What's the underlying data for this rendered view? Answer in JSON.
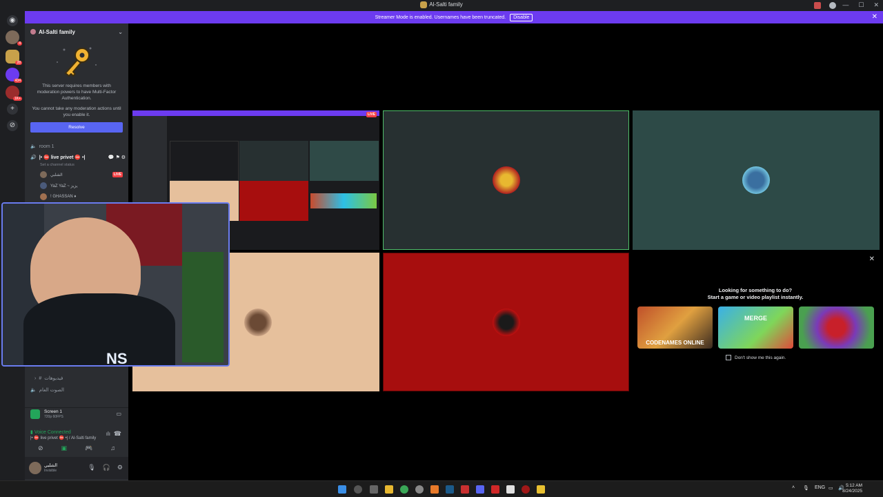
{
  "window": {
    "title": "Al-Salti family"
  },
  "banner": {
    "message": "Streamer Mode is enabled. Usernames have been truncated.",
    "disable_label": "Disable"
  },
  "rail": {
    "badges": [
      "4",
      "28",
      "434",
      "1K+"
    ]
  },
  "server": {
    "name": "Al-Salti family"
  },
  "mfa": {
    "line1": "This server requires members with moderation powers to have Multi-Factor Authentication.",
    "line2": "You cannot take any moderation actions until you enable it.",
    "resolve_label": "Resolve"
  },
  "channels": {
    "room1": "room 1",
    "live": "|• ⛔ live privet ⛔ •|",
    "status": "Set a channel status",
    "members": [
      {
        "name": "الشلبي",
        "live": "LIVE"
      },
      {
        "name": "YaZ YaZ ~ يزيز"
      },
      {
        "name": "! GHASSAN ♦"
      }
    ],
    "videos": "فيديوهات",
    "voice_general": "الصوت العام"
  },
  "screen_share": {
    "title": "Screen 1",
    "quality": "720p 60FPS"
  },
  "voice": {
    "status": "Voice Connected",
    "channel": "|• ⛔ live privet ⛔ •| / Al-Salti family"
  },
  "user": {
    "name": "الشلبي",
    "status": "Invisible"
  },
  "live_tag": "LIVE",
  "activity": {
    "heading1": "Looking for something to do?",
    "heading2": "Start a game or video playlist instantly.",
    "games": [
      "CODENAMES ONLINE",
      "MERGE",
      ""
    ],
    "dont_show": "Don't show me this again."
  },
  "taskbar": {
    "lang": "ENG",
    "time": "5:12 AM",
    "date": "8/24/2025"
  },
  "colors": {
    "brand": "#5865f2",
    "banner": "#6c3bf0",
    "live": "#f23f43",
    "voice_green": "#23a55a"
  }
}
